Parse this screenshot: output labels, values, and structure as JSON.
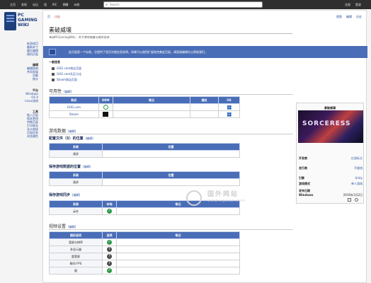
{
  "topbar": {
    "menu": [
      "主页",
      "发现",
      "论坛",
      "组",
      "IRC",
      "捐赠",
      "纠纷"
    ],
    "search_placeholder": "Search",
    "right": [
      "注册",
      "登录"
    ]
  },
  "logo": {
    "pc": "PC",
    "line1": "GAMING",
    "line2": "WIKI"
  },
  "sidebar": {
    "group1": [
      "新游戏页",
      "最新补丁",
      "最近编辑",
      "随机页面"
    ],
    "group2_head": "编辑",
    "group2": [
      "编辑指南",
      "共同发展",
      "贡献",
      "统计"
    ],
    "group3_head": "平台",
    "group3": [
      "Windows",
      "OS X",
      "Linux游戏"
    ],
    "group4_head": "工具",
    "group4": [
      "链入页面",
      "相关更改",
      "特殊页面",
      "打印版本",
      "永久链接",
      "页面信息",
      "浏览属性"
    ]
  },
  "tabs_left": [
    "页",
    "讨论"
  ],
  "tabs_right": [
    "视图",
    "编辑",
    "历史"
  ],
  "page": {
    "title": "素破威壤",
    "subtitle": "来自PCGamingWiki，关于游戏修复与相关信息",
    "notice": "此页面是一个存根。它提供了首页详细信息说明，如果可以使用扩展和完善此页面，请直接编辑它以帮助我们。"
  },
  "general": {
    "head": "一般信息",
    "stores": [
      "GOG.com商店页面",
      "GOG.com社区讨论",
      "Steam商店页面"
    ]
  },
  "availability": {
    "heading": "可用性",
    "edit": "[编辑]",
    "cols": [
      "购买",
      "DRM",
      "笔记",
      "键位",
      "OS"
    ],
    "rows": [
      {
        "store": "GOG.com",
        "drm": "gog",
        "os": "win"
      },
      {
        "store": "Steam",
        "drm": "steam",
        "os": "win"
      }
    ]
  },
  "gamedata": {
    "heading": "游戏数据",
    "edit": "[编辑]",
    "config_heading": "配置文件（S）的位置",
    "config_cols": [
      "系统",
      "位置"
    ],
    "config_row": "请求",
    "save_heading": "保存游戏数据的位置",
    "save_cols": [
      "系统",
      "位置"
    ],
    "save_row": "请求",
    "sync_heading": "保存游戏同步",
    "sync_cols": [
      "系统",
      "本地",
      "笔记"
    ],
    "sync_row": "云存"
  },
  "video": {
    "heading": "视频设置",
    "edit": "[编辑]",
    "cols": [
      "图形选项",
      "选项",
      "笔记"
    ],
    "rows": [
      "宽屏分辨率",
      "多显示器",
      "超宽屏",
      "瞬间 FPS",
      "窗"
    ],
    "states": [
      "ok",
      "q",
      "q",
      "q",
      "ok"
    ]
  },
  "infobox": {
    "title": "素破威壤",
    "cover_text": "SORCERESS",
    "rows": [
      {
        "k": "开发商",
        "v": "红鼠标主"
      },
      {
        "k": "发行商",
        "v": "不限线"
      },
      {
        "k": "引擎",
        "v": "Unity"
      },
      {
        "k": "游戏模式",
        "v": "单人游戏"
      },
      {
        "k": "发布日期",
        "v": ""
      },
      {
        "k": "Windows",
        "v": "2016年1月2日"
      }
    ]
  },
  "watermark": {
    "cn": "国外网站",
    "url": "www.egouz.com"
  }
}
